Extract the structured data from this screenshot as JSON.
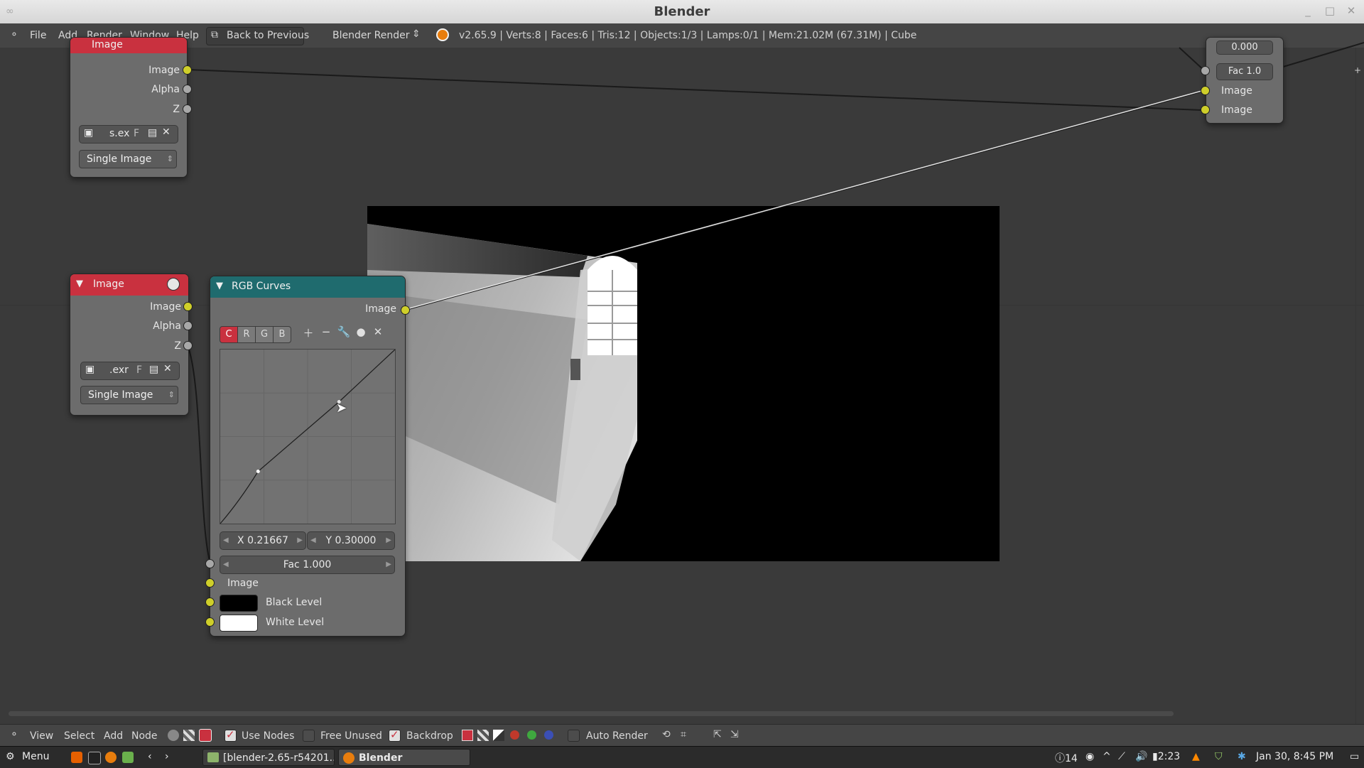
{
  "window": {
    "title": "Blender"
  },
  "infobar": {
    "menus": [
      "File",
      "Add",
      "Render",
      "Window",
      "Help"
    ],
    "back_button": "Back to Previous",
    "engine": "Blender Render",
    "stats": "v2.65.9 | Verts:8 | Faces:6 | Tris:12 | Objects:1/3 | Lamps:0/1 | Mem:21.02M (67.31M) | Cube"
  },
  "nodes": {
    "image_top": {
      "title": "Image",
      "outputs": [
        "Image",
        "Alpha",
        "Z"
      ],
      "file": "s.ex",
      "file_flag": "F",
      "source": "Single Image"
    },
    "image_mid": {
      "title": "Image",
      "outputs": [
        "Image",
        "Alpha",
        "Z"
      ],
      "file": ".exr",
      "file_flag": "F",
      "source": "Single Image"
    },
    "rgb_curves": {
      "title": "RGB Curves",
      "output": "Image",
      "channels": [
        "C",
        "R",
        "G",
        "B"
      ],
      "active_channel": "C",
      "x_field": "X 0.21667",
      "y_field": "Y 0.30000",
      "fac": "Fac 1.000",
      "inputs": [
        "Image",
        "Black Level",
        "White Level"
      ],
      "black_level_color": "#000000",
      "white_level_color": "#ffffff",
      "curve_points": [
        [
          0.0,
          0.0
        ],
        [
          0.21667,
          0.3
        ],
        [
          0.68,
          0.7
        ],
        [
          1.0,
          1.0
        ]
      ]
    },
    "right_node": {
      "top_value": "0.000",
      "fac": "Fac 1.0",
      "inputs": [
        "Image",
        "Image"
      ]
    }
  },
  "nodebar": {
    "menus": [
      "View",
      "Select",
      "Add",
      "Node"
    ],
    "use_nodes": "Use Nodes",
    "free_unused": "Free Unused",
    "backdrop": "Backdrop",
    "auto_render": "Auto Render"
  },
  "taskbar": {
    "menu": "Menu",
    "task1": "[blender-2.65-r54201...",
    "task2": "Blender",
    "notif_count": "14",
    "battery": "2:23",
    "datetime": "Jan 30,  8:45 PM"
  },
  "colors": {
    "image_node_header": "#c9313f",
    "curves_node_header": "#1f6b6e",
    "socket_yellow": "#cfcf2a",
    "socket_gray": "#a8a8a8"
  }
}
